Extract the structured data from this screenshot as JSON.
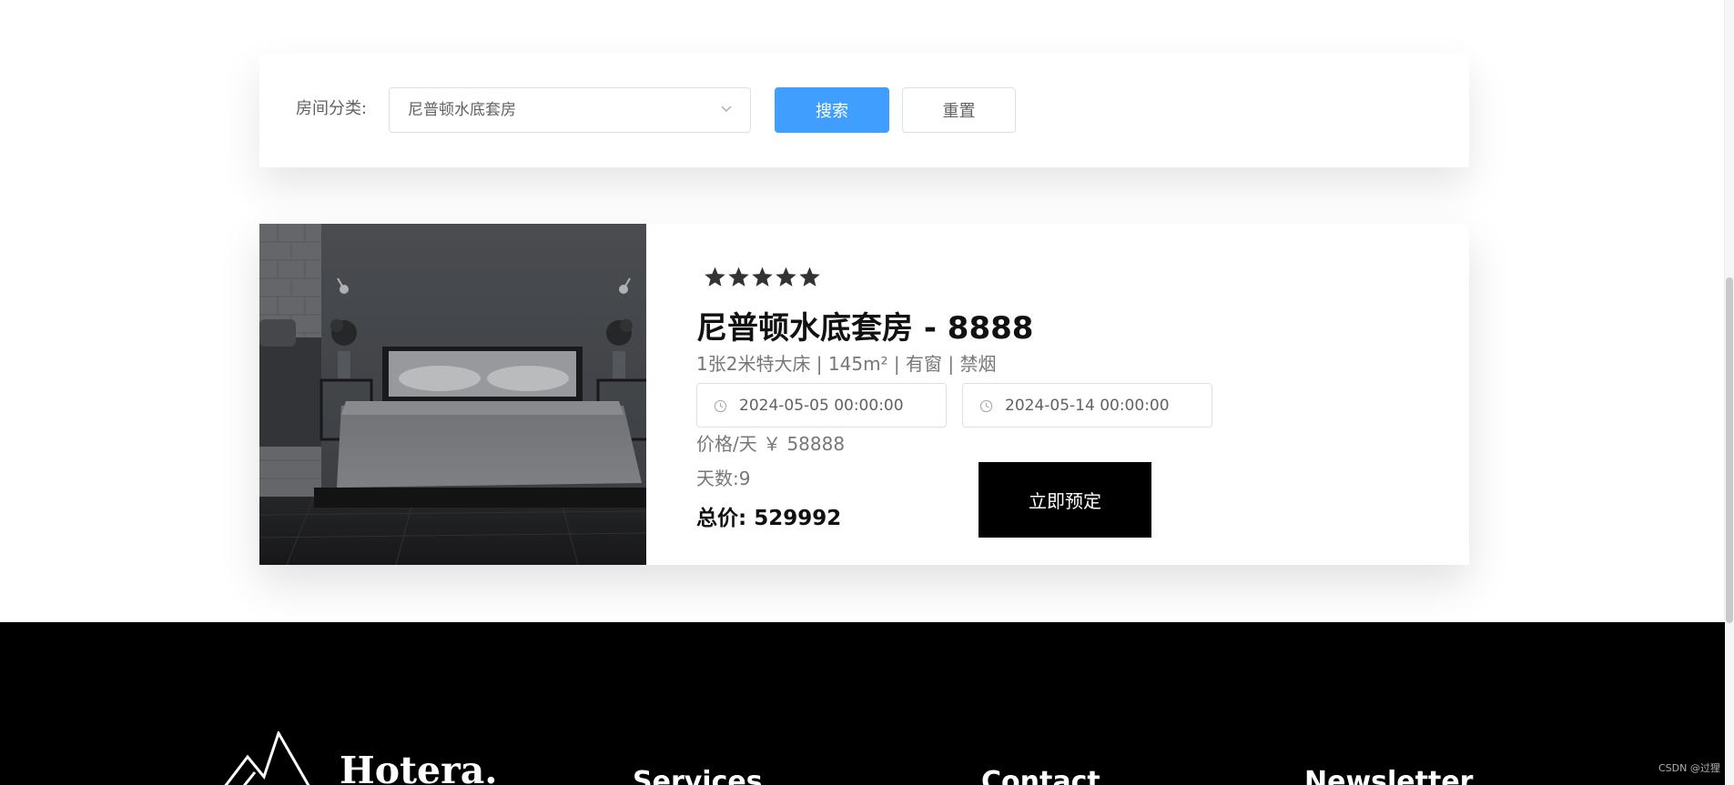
{
  "search": {
    "category_label": "房间分类:",
    "category_selected": "尼普顿水底套房",
    "search_button": "搜索",
    "reset_button": "重置"
  },
  "room": {
    "stars": 5,
    "title": "尼普顿水底套房 - 8888",
    "features": "1张2米特大床 | 145m² | 有窗 | 禁烟",
    "checkin": "2024-05-05 00:00:00",
    "checkout": "2024-05-14 00:00:00",
    "price_text": "价格/天 ￥ 58888",
    "days_text": "天数:9",
    "total_text": "总价: 529992",
    "book_button": "立即预定"
  },
  "footer": {
    "brand": "Hotera.",
    "headings": [
      "Services",
      "Contact",
      "Newsletter"
    ]
  },
  "watermark": "CSDN @过狸",
  "colors": {
    "primary": "#409eff",
    "dark": "#000000",
    "muted_text": "#777777",
    "border": "#dcdfe6"
  },
  "icons": {
    "select_arrow": "chevron-down-icon",
    "date": "clock-icon",
    "rating": "star-icon",
    "logo": "mountain-logo-icon"
  }
}
